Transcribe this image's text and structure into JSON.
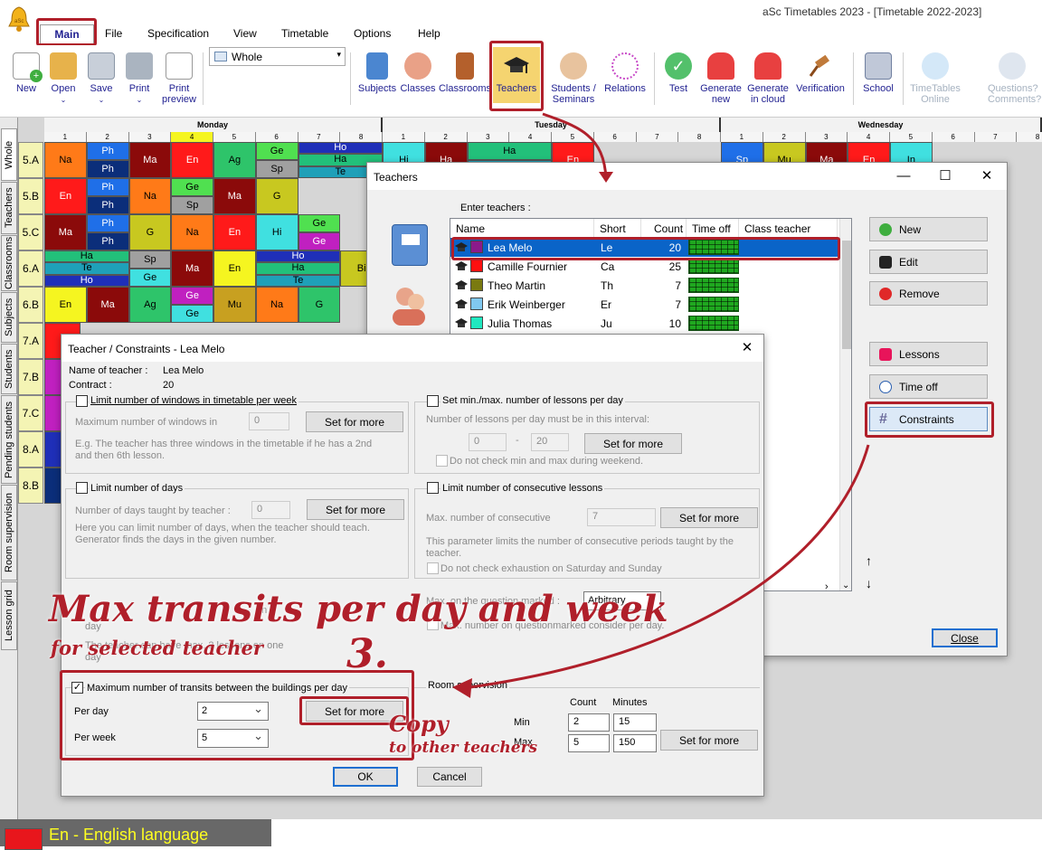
{
  "app": {
    "title": "aSc Timetables 2023  -  [Timetable 2022-2023]"
  },
  "menu": {
    "main": "Main",
    "file": "File",
    "specification": "Specification",
    "view": "View",
    "timetable": "Timetable",
    "options": "Options",
    "help": "Help"
  },
  "toolbar": {
    "new": "New",
    "open": "Open",
    "save": "Save",
    "print": "Print",
    "print_preview_1": "Print",
    "print_preview_2": "preview",
    "view_select": "Whole",
    "subjects": "Subjects",
    "classes": "Classes",
    "classrooms": "Classrooms",
    "teachers": "Teachers",
    "students_1": "Students /",
    "students_2": "Seminars",
    "relations": "Relations",
    "test": "Test",
    "generate_new_1": "Generate",
    "generate_new_2": "new",
    "generate_cloud_1": "Generate",
    "generate_cloud_2": "in cloud",
    "verification": "Verification",
    "school": "School",
    "timetables_online_1": "TimeTables",
    "timetables_online_2": "Online",
    "questions_1": "Questions?",
    "questions_2": "Comments? Wi"
  },
  "vtabs": [
    "Whole",
    "Teachers",
    "Classrooms",
    "Subjects",
    "Students",
    "Pending students",
    "Room supervision",
    "Lesson grid"
  ],
  "grid": {
    "days": [
      "Monday",
      "Tuesday",
      "Wednesday"
    ],
    "periods": [
      "1",
      "2",
      "3",
      "4",
      "5",
      "6",
      "7",
      "8"
    ],
    "classes": [
      "5.A",
      "5.B",
      "5.C",
      "6.A",
      "6.B",
      "7.A",
      "7.B",
      "7.C",
      "8.A",
      "8.B"
    ],
    "cells": {
      "c1": "Na",
      "c2": "Ph",
      "c3": "Ph",
      "c4": "Ma",
      "c5": "En",
      "c6": "Ag",
      "c7": "Ge",
      "c8": "Sp",
      "c9": "Ho",
      "c10": "Ha",
      "c11": "Te",
      "c12": "En",
      "c13": "Ph",
      "c14": "Ph",
      "c15": "Na",
      "c16": "Ge",
      "c17": "Sp",
      "c18": "Ma",
      "c19": "G",
      "c20": "Ma",
      "c21": "Ph",
      "c22": "Ph",
      "c23": "G",
      "c24": "Na",
      "c25": "En",
      "c26": "Hi",
      "c27": "Ge",
      "c28": "Ge",
      "c29": "Ha",
      "c30": "Te",
      "c31": "Ho",
      "c32": "Sp",
      "c33": "Ge",
      "c34": "Ma",
      "c35": "En",
      "c36": "Ho",
      "c37": "Ha",
      "c38": "Te",
      "c39": "Bi",
      "c40": "En",
      "c41": "Ma",
      "c42": "Ag",
      "c43": "Ge",
      "c44": "Ge",
      "c45": "Mu",
      "c46": "Na",
      "c47": "G",
      "c48": "Hi",
      "c49": "Ha",
      "c50": "Ha",
      "c51": "Te",
      "c52": "En",
      "c53": "Sp",
      "c54": "Mu",
      "c55": "Ma",
      "c56": "En",
      "c57": "In"
    }
  },
  "status": {
    "text": "En - English language",
    "swatch_color": "#e8161c"
  },
  "teachers_window": {
    "title": "Teachers",
    "enter_label": "Enter teachers :",
    "columns": {
      "name": "Name",
      "short": "Short",
      "count": "Count",
      "time_off": "Time off",
      "class_teacher": "Class teacher"
    },
    "rows": [
      {
        "name": "Lea Melo",
        "short": "Le",
        "count": "20",
        "color": "#8b1a8b"
      },
      {
        "name": "Camille Fournier",
        "short": "Ca",
        "count": "25",
        "color": "#ff1010"
      },
      {
        "name": "Theo Martin",
        "short": "Th",
        "count": "7",
        "color": "#7a7a10"
      },
      {
        "name": "Erik Weinberger",
        "short": "Er",
        "count": "7",
        "color": "#80c8f0"
      },
      {
        "name": "Julia Thomas",
        "short": "Ju",
        "count": "10",
        "color": "#20e8c0"
      }
    ],
    "buttons": {
      "new": "New",
      "edit": "Edit",
      "remove": "Remove",
      "lessons": "Lessons",
      "time_off": "Time off",
      "constraints": "Constraints",
      "close": "Close"
    }
  },
  "constraints_window": {
    "title": "Teacher / Constraints - Lea Melo",
    "name_label": "Name of teacher :",
    "name_value": "Lea Melo",
    "contract_label": "Contract :",
    "contract_value": "20",
    "windows": {
      "title": "Limit number of windows in timetable per week",
      "max_label": "Maximum number of windows in",
      "max_value": "0",
      "set_for_more": "Set for more",
      "hint1": "E.g. The teacher has three windows in the timetable if he has a 2nd",
      "hint2": "and then 6th lesson."
    },
    "minmax": {
      "title": "Set min./max. number of lessons per day",
      "label": "Number of lessons per day must be in this interval:",
      "min": "0",
      "dash": "-",
      "max": "20",
      "set_for_more": "Set for more",
      "weekend": "Do not check min and max during weekend."
    },
    "days": {
      "title": "Limit number of days",
      "label": "Number of days taught by teacher :",
      "value": "0",
      "set_for_more": "Set for more",
      "hint1": "Here you can limit number of days, when the teacher should teach.",
      "hint2": "Generator finds the days in the given number."
    },
    "consecutive": {
      "title": "Limit number of consecutive lessons",
      "label": "Max. number of consecutive",
      "value": "7",
      "set_for_more": "Set for more",
      "hint1": "This parameter limits the number of consecutive periods taught by the",
      "hint2": "teacher.",
      "exhaustion": "Do not check exhaustion on Saturday and Sunday"
    },
    "question": {
      "label": "Max. on the question marked :",
      "value": "Arbitrary",
      "consider": "Max. number on questionmarked consider per day."
    },
    "partial_hidden": {
      "day": "day",
      "text1": "The teacher can have max. 2 lessons on one",
      "day2": "day"
    },
    "transits": {
      "title": "Maximum number of transits between the buildings per day",
      "checked": "✓",
      "per_day_label": "Per day",
      "per_day_value": "2",
      "per_week_label": "Per week",
      "per_week_value": "5",
      "set_for_more": "Set for more"
    },
    "room_supervision": {
      "title": "Room supervision",
      "count_hdr": "Count",
      "minutes_hdr": "Minutes",
      "min_label": "Min",
      "min_count": "2",
      "min_minutes": "15",
      "max_label": "Max",
      "max_count": "5",
      "max_minutes": "150",
      "set_for_more": "Set for more"
    },
    "ok": "OK",
    "cancel": "Cancel"
  },
  "annotations": {
    "headline": "Max transits per day and week",
    "sub": "for selected teacher",
    "step": "3.",
    "copy": "Copy",
    "copy_sub": "to other teachers"
  },
  "colors": {
    "accent_red": "#b01f2a",
    "selection_blue": "#0a64c8"
  }
}
